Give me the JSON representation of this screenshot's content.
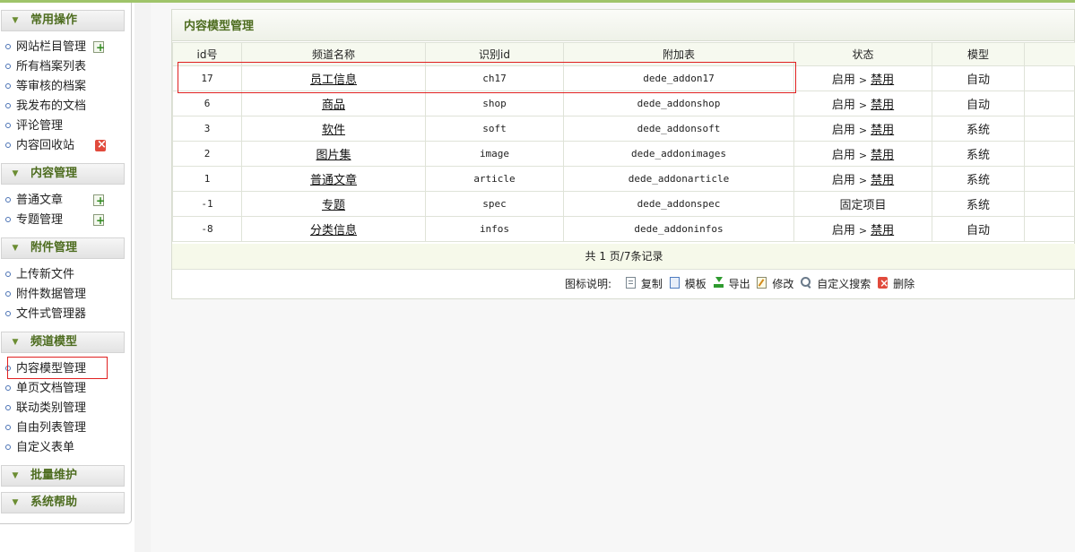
{
  "sidebar": {
    "groups": [
      {
        "title": "常用操作",
        "items": [
          {
            "label": "网站栏目管理",
            "badge": "add"
          },
          {
            "label": "所有档案列表"
          },
          {
            "label": "等审核的档案"
          },
          {
            "label": "我发布的文档"
          },
          {
            "label": "评论管理"
          },
          {
            "label": "内容回收站",
            "badge": "delete"
          }
        ]
      },
      {
        "title": "内容管理",
        "items": [
          {
            "label": "普通文章",
            "badge": "add"
          },
          {
            "label": "专题管理",
            "badge": "add"
          }
        ]
      },
      {
        "title": "附件管理",
        "items": [
          {
            "label": "上传新文件"
          },
          {
            "label": "附件数据管理"
          },
          {
            "label": "文件式管理器"
          }
        ]
      },
      {
        "title": "频道模型",
        "items": [
          {
            "label": "内容模型管理"
          },
          {
            "label": "单页文档管理"
          },
          {
            "label": "联动类别管理"
          },
          {
            "label": "自由列表管理"
          },
          {
            "label": "自定义表单"
          }
        ]
      },
      {
        "title": "批量维护",
        "items": []
      },
      {
        "title": "系统帮助",
        "items": []
      }
    ]
  },
  "panel": {
    "title": "内容模型管理",
    "columns": [
      "id号",
      "频道名称",
      "识别id",
      "附加表",
      "状态",
      "模型"
    ],
    "rows": [
      {
        "id": "17",
        "name": "员工信息",
        "nid": "ch17",
        "table": "dede_addon17",
        "status_on": "启用",
        "status_off": "禁用",
        "model": "自动"
      },
      {
        "id": "6",
        "name": "商品",
        "nid": "shop",
        "table": "dede_addonshop",
        "status_on": "启用",
        "status_off": "禁用",
        "model": "自动"
      },
      {
        "id": "3",
        "name": "软件",
        "nid": "soft",
        "table": "dede_addonsoft",
        "status_on": "启用",
        "status_off": "禁用",
        "model": "系统"
      },
      {
        "id": "2",
        "name": "图片集",
        "nid": "image",
        "table": "dede_addonimages",
        "status_on": "启用",
        "status_off": "禁用",
        "model": "系统"
      },
      {
        "id": "1",
        "name": "普通文章",
        "nid": "article",
        "table": "dede_addonarticle",
        "status_on": "启用",
        "status_off": "禁用",
        "model": "系统"
      },
      {
        "id": "-1",
        "name": "专题",
        "nid": "spec",
        "table": "dede_addonspec",
        "status_fixed": "固定项目",
        "model": "系统"
      },
      {
        "id": "-8",
        "name": "分类信息",
        "nid": "infos",
        "table": "dede_addoninfos",
        "status_on": "启用",
        "status_off": "禁用",
        "model": "自动"
      }
    ],
    "status_separator": ">",
    "pager": "共 1 页/7条记录",
    "legend": {
      "title": "图标说明:",
      "items": [
        {
          "icon": "copy-icon",
          "label": "复制"
        },
        {
          "icon": "template-icon",
          "label": "模板"
        },
        {
          "icon": "export-icon",
          "label": "导出"
        },
        {
          "icon": "edit-icon",
          "label": "修改"
        },
        {
          "icon": "search-icon",
          "label": "自定义搜索"
        },
        {
          "icon": "delete-icon",
          "label": "删除"
        }
      ]
    }
  },
  "colors": {
    "accent_green": "#4d6c1f",
    "highlight_red": "#e02020",
    "pager_bg": "#f6f9ea"
  }
}
